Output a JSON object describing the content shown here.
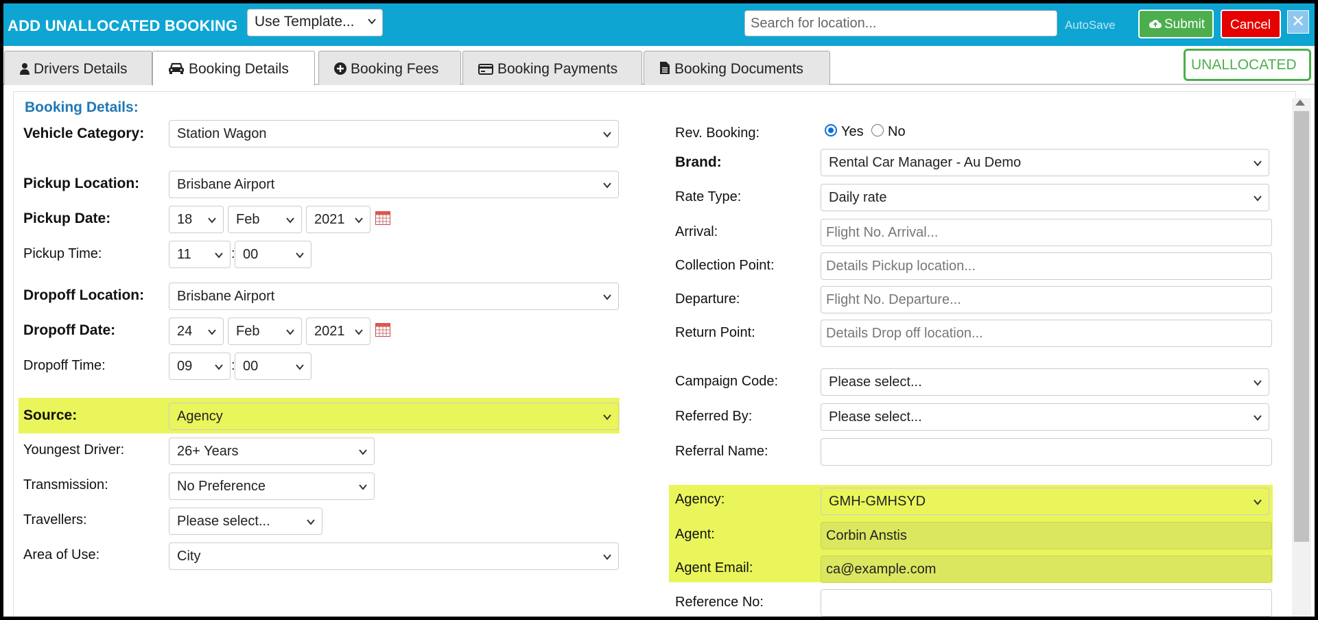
{
  "header": {
    "title": "ADD UNALLOCATED BOOKING",
    "template_select": "Use Template...",
    "search_placeholder": "Search for location...",
    "autosave": "AutoSave",
    "submit_label": "Submit",
    "cancel_label": "Cancel",
    "close_label": "✕"
  },
  "tabs": [
    {
      "label": "Drivers Details",
      "icon": "user-icon"
    },
    {
      "label": "Booking Details",
      "icon": "car-icon"
    },
    {
      "label": "Booking Fees",
      "icon": "plus-circle-icon"
    },
    {
      "label": "Booking Payments",
      "icon": "credit-card-icon"
    },
    {
      "label": "Booking Documents",
      "icon": "document-icon"
    }
  ],
  "status": "UNALLOCATED",
  "section_title": "Booking Details:",
  "left": {
    "vehicle_category": {
      "label": "Vehicle Category:",
      "value": "Station Wagon"
    },
    "pickup_location": {
      "label": "Pickup Location:",
      "value": "Brisbane Airport"
    },
    "pickup_date": {
      "label": "Pickup Date:",
      "day": "18",
      "month": "Feb",
      "year": "2021"
    },
    "pickup_time": {
      "label": "Pickup Time:",
      "hour": "11",
      "minute": "00"
    },
    "dropoff_location": {
      "label": "Dropoff Location:",
      "value": "Brisbane Airport"
    },
    "dropoff_date": {
      "label": "Dropoff Date:",
      "day": "24",
      "month": "Feb",
      "year": "2021"
    },
    "dropoff_time": {
      "label": "Dropoff Time:",
      "hour": "09",
      "minute": "00"
    },
    "source": {
      "label": "Source:",
      "value": "Agency"
    },
    "youngest_driver": {
      "label": "Youngest Driver:",
      "value": "26+ Years"
    },
    "transmission": {
      "label": "Transmission:",
      "value": "No Preference"
    },
    "travellers": {
      "label": "Travellers:",
      "value": "Please select..."
    },
    "area_of_use": {
      "label": "Area of Use:",
      "value": "City"
    }
  },
  "right": {
    "rev_booking": {
      "label": "Rev. Booking:",
      "yes": "Yes",
      "no": "No",
      "selected": "Yes"
    },
    "brand": {
      "label": "Brand:",
      "value": "Rental Car Manager - Au Demo"
    },
    "rate_type": {
      "label": "Rate Type:",
      "value": "Daily rate"
    },
    "arrival": {
      "label": "Arrival:",
      "placeholder": "Flight No. Arrival..."
    },
    "collection_point": {
      "label": "Collection Point:",
      "placeholder": "Details Pickup location..."
    },
    "departure": {
      "label": "Departure:",
      "placeholder": "Flight No. Departure..."
    },
    "return_point": {
      "label": "Return Point:",
      "placeholder": "Details Drop off location..."
    },
    "campaign_code": {
      "label": "Campaign Code:",
      "value": "Please select..."
    },
    "referred_by": {
      "label": "Referred By:",
      "value": "Please select..."
    },
    "referral_name": {
      "label": "Referral Name:",
      "value": ""
    },
    "agency": {
      "label": "Agency:",
      "value": "GMH-GMHSYD"
    },
    "agent": {
      "label": "Agent:",
      "value": "Corbin Anstis"
    },
    "agent_email": {
      "label": "Agent Email:",
      "value": "ca@example.com"
    },
    "reference_no": {
      "label": "Reference No:",
      "value": ""
    }
  },
  "colors": {
    "header_bg": "#0ea5d3",
    "highlight": "#e9f55a",
    "submit": "#4cae4c",
    "cancel": "#e60000",
    "section_title": "#1f78b4"
  }
}
